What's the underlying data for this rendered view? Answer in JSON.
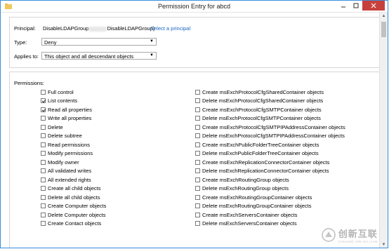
{
  "window": {
    "title": "Permission Entry for abcd"
  },
  "form": {
    "principal_label": "Principal:",
    "principal_name_start": "DisableLDAPGroup",
    "principal_name_end": "DisableLDAPGroup)",
    "select_principal_link": "Select a principal",
    "type_label": "Type:",
    "type_value": "Deny",
    "applies_label": "Applies to:",
    "applies_value": "This object and all descendant objects"
  },
  "permissions": {
    "label": "Permissions:",
    "left": [
      {
        "label": "Full control",
        "checked": false
      },
      {
        "label": "List contents",
        "checked": true
      },
      {
        "label": "Read all properties",
        "checked": true
      },
      {
        "label": "Write all properties",
        "checked": false
      },
      {
        "label": "Delete",
        "checked": false
      },
      {
        "label": "Delete subtree",
        "checked": false
      },
      {
        "label": "Read permissions",
        "checked": false
      },
      {
        "label": "Modify permissions",
        "checked": false
      },
      {
        "label": "Modify owner",
        "checked": false
      },
      {
        "label": "All validated writes",
        "checked": false
      },
      {
        "label": "All extended rights",
        "checked": false
      },
      {
        "label": "Create all child objects",
        "checked": false
      },
      {
        "label": "Delete all child objects",
        "checked": false
      },
      {
        "label": "Create Computer objects",
        "checked": false
      },
      {
        "label": "Delete Computer objects",
        "checked": false
      },
      {
        "label": "Create Contact objects",
        "checked": false
      }
    ],
    "right": [
      {
        "label": "Create msExchProtocolCfgSharedContainer objects",
        "checked": false
      },
      {
        "label": "Delete msExchProtocolCfgSharedContainer objects",
        "checked": false
      },
      {
        "label": "Create msExchProtocolCfgSMTPContainer objects",
        "checked": false
      },
      {
        "label": "Delete msExchProtocolCfgSMTPContainer objects",
        "checked": false
      },
      {
        "label": "Create msExchProtocolCfgSMTPIPAddressContainer objects",
        "checked": false
      },
      {
        "label": "Delete msExchProtocolCfgSMTPIPAddressContainer objects",
        "checked": false
      },
      {
        "label": "Create msExchPublicFolderTreeContainer objects",
        "checked": false
      },
      {
        "label": "Delete msExchPublicFolderTreeContainer objects",
        "checked": false
      },
      {
        "label": "Create msExchReplicationConnectorContainer objects",
        "checked": false
      },
      {
        "label": "Delete msExchReplicationConnectorContainer objects",
        "checked": false
      },
      {
        "label": "Create msExchRoutingGroup objects",
        "checked": false
      },
      {
        "label": "Delete msExchRoutingGroup objects",
        "checked": false
      },
      {
        "label": "Create msExchRoutingGroupContainer objects",
        "checked": false
      },
      {
        "label": "Delete msExchRoutingGroupContainer objects",
        "checked": false
      },
      {
        "label": "Create msExchServersContainer objects",
        "checked": false
      },
      {
        "label": "Delete msExchServersContainer objects",
        "checked": false
      }
    ]
  },
  "watermark": {
    "cn": "创新互联",
    "en": "CHUANG XIN HU LIAN"
  },
  "colors": {
    "accent": "#3a8ede",
    "link": "#1a63c4",
    "close": "#c7413c"
  }
}
